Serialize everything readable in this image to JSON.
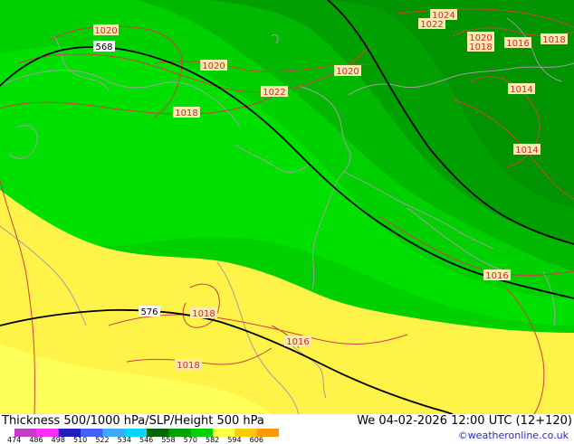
{
  "footer": {
    "title": "Thickness 500/1000 hPa/SLP/Height 500 hPa",
    "datetime": "We 04-02-2026 12:00 UTC (12+120)",
    "credit": "©weatheronline.co.uk"
  },
  "legend": {
    "ticks": [
      "474",
      "486",
      "498",
      "510",
      "522",
      "534",
      "546",
      "558",
      "570",
      "582",
      "594",
      "606"
    ],
    "colors": [
      "#c040c0",
      "#ff30ff",
      "#2020c0",
      "#4060ff",
      "#40a8ff",
      "#00d8ff",
      "#006400",
      "#00a000",
      "#00d200",
      "#ffff40",
      "#ffcc00",
      "#ff9a00"
    ]
  },
  "map": {
    "colors": {
      "dark_green": "#00a000",
      "darker_green": "#009400",
      "mid_green": "#00b800",
      "green": "#00cf00",
      "bright_green": "#00e000",
      "yellow": "#fff34a",
      "yellow_light": "#ffff5a",
      "slp_line": "#d04040",
      "border_line": "#a0a0a0",
      "height_line": "#000000"
    },
    "height_labels": [
      {
        "id": "568",
        "text": "568"
      },
      {
        "id": "576",
        "text": "576"
      }
    ],
    "slp_labels": [
      {
        "id": "a",
        "text": "1020"
      },
      {
        "id": "b",
        "text": "1024"
      },
      {
        "id": "c",
        "text": "1022"
      },
      {
        "id": "d",
        "text": "1020"
      },
      {
        "id": "e",
        "text": "1018"
      },
      {
        "id": "f",
        "text": "1016"
      },
      {
        "id": "g",
        "text": "1018"
      },
      {
        "id": "h",
        "text": "1020"
      },
      {
        "id": "i",
        "text": "1020"
      },
      {
        "id": "j",
        "text": "1022"
      },
      {
        "id": "k",
        "text": "1018"
      },
      {
        "id": "l",
        "text": "1014"
      },
      {
        "id": "m",
        "text": "1014"
      },
      {
        "id": "n",
        "text": "1016"
      },
      {
        "id": "o",
        "text": "1018"
      },
      {
        "id": "p",
        "text": "1016"
      },
      {
        "id": "q",
        "text": "1018"
      }
    ]
  }
}
